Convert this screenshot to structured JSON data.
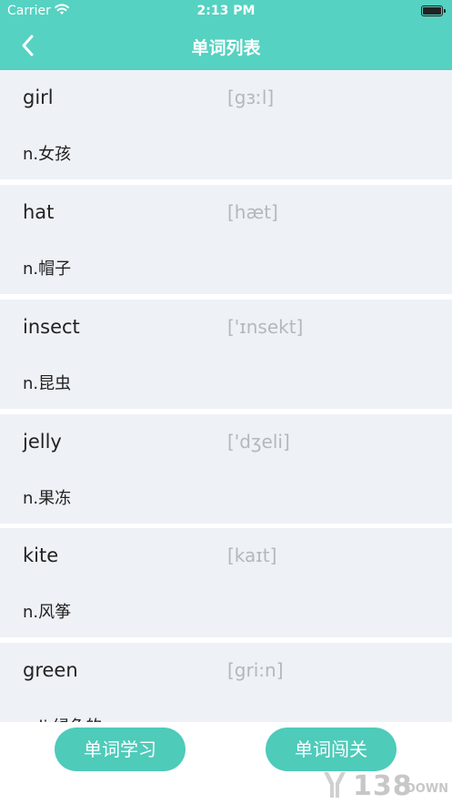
{
  "status_bar": {
    "carrier": "Carrier",
    "time": "2:13 PM",
    "icons": [
      "wifi-icon",
      "battery-icon"
    ]
  },
  "nav": {
    "title": "单词列表",
    "back_icon": "chevron-left-icon"
  },
  "words": [
    {
      "word": "girl",
      "phonetic": "[gɜːl]",
      "meaning": "n.女孩"
    },
    {
      "word": "hat",
      "phonetic": "[hæt]",
      "meaning": "n.帽子"
    },
    {
      "word": "insect",
      "phonetic": "['ɪnsekt]",
      "meaning": "n.昆虫"
    },
    {
      "word": "jelly",
      "phonetic": "['dʒeli]",
      "meaning": "n.果冻"
    },
    {
      "word": "kite",
      "phonetic": "[kaɪt]",
      "meaning": "n.风筝"
    },
    {
      "word": "green",
      "phonetic": "[gri:n]",
      "meaning": "adj.绿色的"
    }
  ],
  "buttons": {
    "study_label": "单词学习",
    "challenge_label": "单词闯关"
  },
  "watermark": {
    "number": "138",
    "suffix": "DOWN"
  },
  "colors": {
    "header": "#55d2c1",
    "button": "#4ecbb9",
    "card": "#eef1f6",
    "phonetic": "#b4b8be"
  }
}
